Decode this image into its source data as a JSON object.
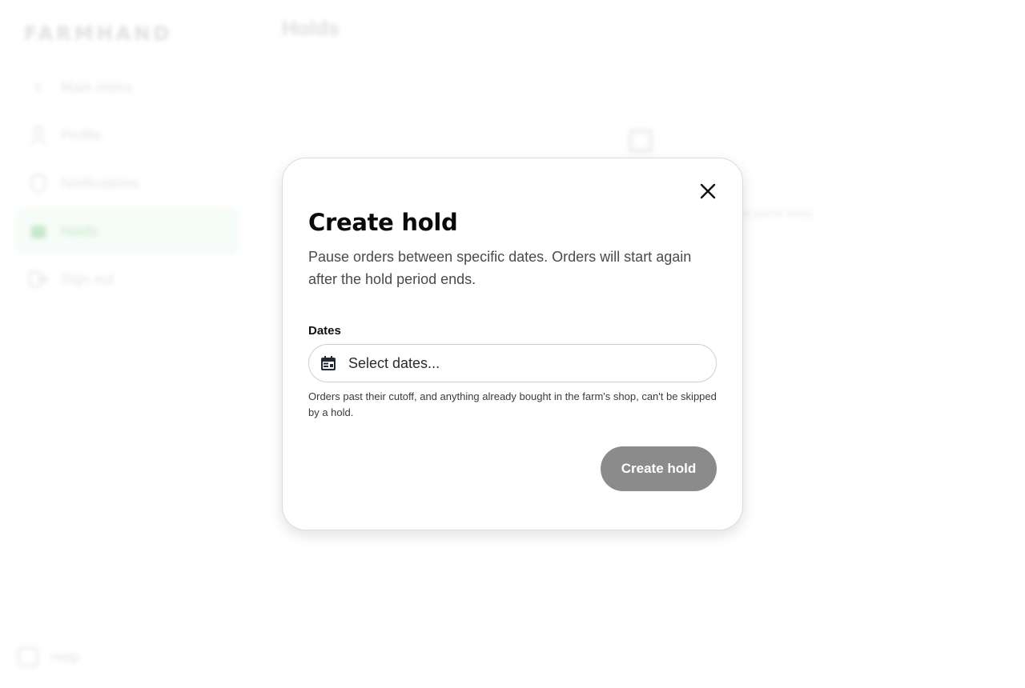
{
  "brand": "FARMHAND",
  "sidebar": {
    "items": [
      {
        "label": "Main menu",
        "icon": "chevron-left-icon"
      },
      {
        "label": "Profile",
        "icon": "person-icon"
      },
      {
        "label": "Notifications",
        "icon": "shield-icon"
      },
      {
        "label": "Holds",
        "icon": "calendar-icon",
        "active": true
      },
      {
        "label": "Sign out",
        "icon": "sign-out-icon"
      }
    ],
    "help": "Help"
  },
  "main": {
    "title": "Holds",
    "empty_text": "while you're away"
  },
  "modal": {
    "title": "Create hold",
    "description": "Pause orders between specific dates. Orders will start again after the hold period ends.",
    "dates_label": "Dates",
    "dates_placeholder": "Select dates...",
    "hint": "Orders past their cutoff, and anything already bought in the farm's shop, can't be skipped by a hold.",
    "submit_label": "Create hold"
  },
  "colors": {
    "active_nav": "#a8dcb0",
    "button_disabled": "#8b8b8b"
  }
}
